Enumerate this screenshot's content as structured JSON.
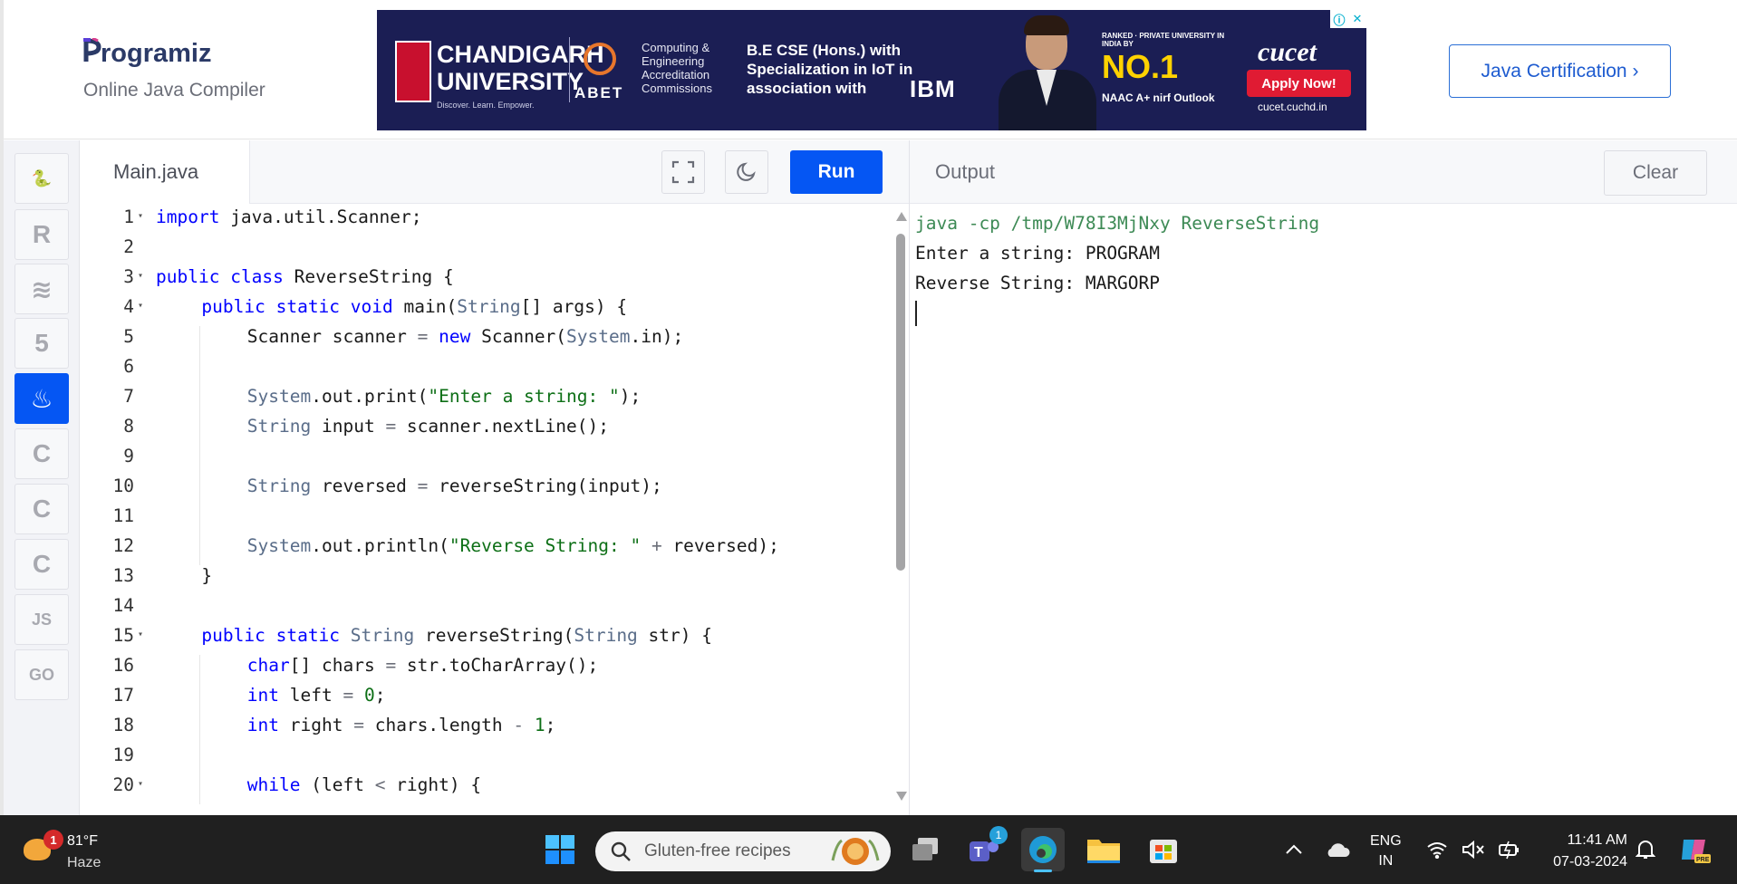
{
  "header": {
    "logo_text": "rogramiz",
    "subtitle": "Online Java Compiler",
    "cta_label": "Java Certification ›"
  },
  "ad": {
    "university": "CHANDIGARH UNIVERSITY",
    "tagline": "Discover. Learn. Empower.",
    "abet": "ABET",
    "accreditation": "Computing & Engineering Accreditation Commissions",
    "program": "B.E CSE (Hons.) with Specialization in IoT in association with",
    "partner": "IBM",
    "ranking": "NO.1",
    "ranking_note": "RANKED · PRIVATE UNIVERSITY IN INDIA BY",
    "rank_sources": "NAAC A+  nirf  Outlook",
    "brand": "cucet",
    "apply": "Apply Now!",
    "site": "cucet.cuchd.in"
  },
  "sidebar": {
    "items": [
      {
        "icon": "python-icon",
        "glyph": "🐍"
      },
      {
        "icon": "r-icon",
        "glyph": "R"
      },
      {
        "icon": "sql-icon",
        "glyph": "≋"
      },
      {
        "icon": "html5-icon",
        "glyph": "5"
      },
      {
        "icon": "java-icon",
        "glyph": "♨",
        "active": true
      },
      {
        "icon": "c-icon",
        "glyph": "C"
      },
      {
        "icon": "cpp-icon",
        "glyph": "C"
      },
      {
        "icon": "csharp-icon",
        "glyph": "C"
      },
      {
        "icon": "js-icon",
        "glyph": "JS"
      },
      {
        "icon": "go-icon",
        "glyph": "GO"
      }
    ]
  },
  "editor": {
    "tab_label": "Main.java",
    "run_label": "Run",
    "lines": [
      {
        "n": "1",
        "fold": true,
        "indent": 0,
        "tokens": [
          [
            "kw",
            "import"
          ],
          [
            "",
            " java.util.Scanner;"
          ]
        ]
      },
      {
        "n": "2",
        "indent": 0,
        "tokens": []
      },
      {
        "n": "3",
        "fold": true,
        "indent": 0,
        "tokens": [
          [
            "kw",
            "public"
          ],
          [
            "",
            " "
          ],
          [
            "kw",
            "class"
          ],
          [
            "",
            " ReverseString {"
          ]
        ]
      },
      {
        "n": "4",
        "fold": true,
        "indent": 1,
        "tokens": [
          [
            "kw",
            "public"
          ],
          [
            "",
            " "
          ],
          [
            "kw",
            "static"
          ],
          [
            "",
            " "
          ],
          [
            "kw",
            "void"
          ],
          [
            "",
            " main("
          ],
          [
            "ty",
            "String"
          ],
          [
            "",
            "[] args) {"
          ]
        ]
      },
      {
        "n": "5",
        "indent": 2,
        "tokens": [
          [
            "",
            "Scanner scanner "
          ],
          [
            "op",
            "="
          ],
          [
            "",
            " "
          ],
          [
            "kw",
            "new"
          ],
          [
            "",
            " Scanner("
          ],
          [
            "ty",
            "System"
          ],
          [
            "",
            ".in);"
          ]
        ]
      },
      {
        "n": "6",
        "indent": 2,
        "tokens": []
      },
      {
        "n": "7",
        "indent": 2,
        "tokens": [
          [
            "ty",
            "System"
          ],
          [
            "",
            ".out.print("
          ],
          [
            "st",
            "\"Enter a string: \""
          ],
          [
            "",
            ");"
          ]
        ]
      },
      {
        "n": "8",
        "indent": 2,
        "tokens": [
          [
            "ty",
            "String"
          ],
          [
            "",
            " input "
          ],
          [
            "op",
            "="
          ],
          [
            "",
            " scanner.nextLine();"
          ]
        ]
      },
      {
        "n": "9",
        "indent": 2,
        "tokens": []
      },
      {
        "n": "10",
        "indent": 2,
        "tokens": [
          [
            "ty",
            "String"
          ],
          [
            "",
            " reversed "
          ],
          [
            "op",
            "="
          ],
          [
            "",
            " reverseString(input);"
          ]
        ]
      },
      {
        "n": "11",
        "indent": 2,
        "tokens": []
      },
      {
        "n": "12",
        "indent": 2,
        "tokens": [
          [
            "ty",
            "System"
          ],
          [
            "",
            ".out.println("
          ],
          [
            "st",
            "\"Reverse String: \""
          ],
          [
            "",
            " "
          ],
          [
            "op",
            "+"
          ],
          [
            "",
            " reversed);"
          ]
        ]
      },
      {
        "n": "13",
        "indent": 1,
        "tokens": [
          [
            "",
            "}"
          ]
        ]
      },
      {
        "n": "14",
        "indent": 1,
        "tokens": []
      },
      {
        "n": "15",
        "fold": true,
        "indent": 1,
        "tokens": [
          [
            "kw",
            "public"
          ],
          [
            "",
            " "
          ],
          [
            "kw",
            "static"
          ],
          [
            "",
            " "
          ],
          [
            "ty",
            "String"
          ],
          [
            "",
            " reverseString("
          ],
          [
            "ty",
            "String"
          ],
          [
            "",
            " str) {"
          ]
        ]
      },
      {
        "n": "16",
        "indent": 2,
        "tokens": [
          [
            "kw",
            "char"
          ],
          [
            "",
            "[] chars "
          ],
          [
            "op",
            "="
          ],
          [
            "",
            " str.toCharArray();"
          ]
        ]
      },
      {
        "n": "17",
        "indent": 2,
        "tokens": [
          [
            "kw",
            "int"
          ],
          [
            "",
            " left "
          ],
          [
            "op",
            "="
          ],
          [
            "",
            " "
          ],
          [
            "nm",
            "0"
          ],
          [
            "",
            ";"
          ]
        ]
      },
      {
        "n": "18",
        "indent": 2,
        "tokens": [
          [
            "kw",
            "int"
          ],
          [
            "",
            " right "
          ],
          [
            "op",
            "="
          ],
          [
            "",
            " chars.length "
          ],
          [
            "op",
            "-"
          ],
          [
            "",
            " "
          ],
          [
            "nm",
            "1"
          ],
          [
            "",
            ";"
          ]
        ]
      },
      {
        "n": "19",
        "indent": 2,
        "tokens": []
      },
      {
        "n": "20",
        "fold": true,
        "indent": 2,
        "tokens": [
          [
            "kw",
            "while"
          ],
          [
            "",
            " (left "
          ],
          [
            "op",
            "<"
          ],
          [
            "",
            " right) {"
          ]
        ]
      }
    ]
  },
  "output": {
    "title": "Output",
    "clear_label": "Clear",
    "command": "java -cp /tmp/W78I3MjNxy ReverseString",
    "lines": [
      "Enter a string: PROGRAM",
      "Reverse String: MARGORP"
    ]
  },
  "taskbar": {
    "weather_temp": "81°F",
    "weather_cond": "Haze",
    "weather_badge": "1",
    "search_text": "Gluten-free recipes",
    "teams_badge": "1",
    "lang_line1": "ENG",
    "lang_line2": "IN",
    "time": "11:41 AM",
    "date": "07-03-2024"
  },
  "colors": {
    "accent": "#0556f3",
    "keyword": "#0000ff",
    "string": "#0d6f16",
    "taskbar": "#202020"
  }
}
